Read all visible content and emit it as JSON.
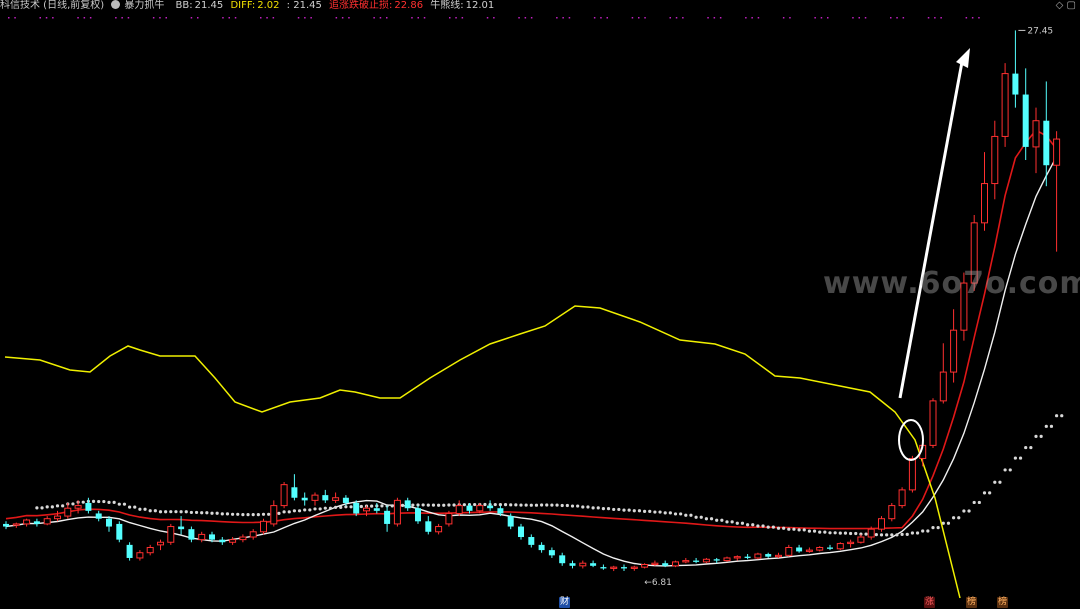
{
  "header": {
    "stock": "科信技术 (日线,前复权)",
    "indicator": "暴力抓牛",
    "bb_label": "BB:",
    "bb_value": "21.45",
    "diff_label": "DIFF:",
    "diff_value": "2.02",
    "sep_value": ": 21.45",
    "stop_label": "追涨跌破止损:",
    "stop_value": "22.86",
    "bull_label": "牛熊线:",
    "bull_value": "12.01"
  },
  "labels": {
    "high": "27.45",
    "low": "6.81"
  },
  "badges": {
    "finance": "财",
    "zhang": "涨",
    "bang1": "榜",
    "bang2": "榜"
  },
  "watermark": "www.6o7o.com",
  "colors": {
    "bg": "#000000",
    "up": "#ff3030",
    "down": "#54ffff",
    "yellow_line": "#f0f000",
    "red_line": "#e01818",
    "white_line": "#f0f0f0",
    "dots": "#d8d8d8",
    "bb": "#d0d0d0",
    "diff": "#f0e000",
    "stop": "#ff3030"
  },
  "chart_data": {
    "type": "candlestick",
    "ylim": [
      6,
      28
    ],
    "high_value": 27.45,
    "low_value": 6.81,
    "candles": [
      [
        8.6,
        8.7,
        8.4,
        8.5
      ],
      [
        8.55,
        8.65,
        8.45,
        8.6
      ],
      [
        8.6,
        8.8,
        8.5,
        8.75
      ],
      [
        8.7,
        8.8,
        8.5,
        8.6
      ],
      [
        8.6,
        8.9,
        8.55,
        8.8
      ],
      [
        8.8,
        9.1,
        8.7,
        8.9
      ],
      [
        8.9,
        9.4,
        8.8,
        9.2
      ],
      [
        9.2,
        9.5,
        9.0,
        9.3
      ],
      [
        9.4,
        9.6,
        9.0,
        9.1
      ],
      [
        9.0,
        9.1,
        8.7,
        8.8
      ],
      [
        8.8,
        8.9,
        8.3,
        8.5
      ],
      [
        8.6,
        8.7,
        7.9,
        8.0
      ],
      [
        7.8,
        7.9,
        7.2,
        7.3
      ],
      [
        7.3,
        7.6,
        7.2,
        7.5
      ],
      [
        7.5,
        7.8,
        7.4,
        7.7
      ],
      [
        7.8,
        8.0,
        7.6,
        7.9
      ],
      [
        7.9,
        8.6,
        7.8,
        8.5
      ],
      [
        8.5,
        8.9,
        8.2,
        8.4
      ],
      [
        8.4,
        8.5,
        7.9,
        8.0
      ],
      [
        8.0,
        8.3,
        7.9,
        8.2
      ],
      [
        8.2,
        8.3,
        7.9,
        8.0
      ],
      [
        8.0,
        8.1,
        7.8,
        7.9
      ],
      [
        7.9,
        8.1,
        7.8,
        8.0
      ],
      [
        8.0,
        8.2,
        7.9,
        8.1
      ],
      [
        8.1,
        8.4,
        8.0,
        8.3
      ],
      [
        8.3,
        8.8,
        8.2,
        8.7
      ],
      [
        8.6,
        9.5,
        8.5,
        9.3
      ],
      [
        9.3,
        10.2,
        9.2,
        10.1
      ],
      [
        10.0,
        10.5,
        9.5,
        9.6
      ],
      [
        9.6,
        9.8,
        9.3,
        9.5
      ],
      [
        9.5,
        9.8,
        9.3,
        9.7
      ],
      [
        9.7,
        9.9,
        9.4,
        9.5
      ],
      [
        9.5,
        9.8,
        9.4,
        9.6
      ],
      [
        9.6,
        9.7,
        9.3,
        9.4
      ],
      [
        9.4,
        9.5,
        8.9,
        9.0
      ],
      [
        9.1,
        9.3,
        8.9,
        9.2
      ],
      [
        9.2,
        9.4,
        9.0,
        9.1
      ],
      [
        9.1,
        9.3,
        8.3,
        8.6
      ],
      [
        8.6,
        9.6,
        8.5,
        9.5
      ],
      [
        9.5,
        9.6,
        9.1,
        9.2
      ],
      [
        9.2,
        9.3,
        8.6,
        8.7
      ],
      [
        8.7,
        8.9,
        8.2,
        8.3
      ],
      [
        8.3,
        8.6,
        8.2,
        8.5
      ],
      [
        8.6,
        9.1,
        8.5,
        9.0
      ],
      [
        9.0,
        9.5,
        8.9,
        9.3
      ],
      [
        9.3,
        9.4,
        9.0,
        9.1
      ],
      [
        9.1,
        9.4,
        9.0,
        9.3
      ],
      [
        9.3,
        9.5,
        9.1,
        9.2
      ],
      [
        9.2,
        9.3,
        8.9,
        9.0
      ],
      [
        8.9,
        9.0,
        8.4,
        8.5
      ],
      [
        8.5,
        8.6,
        8.0,
        8.1
      ],
      [
        8.1,
        8.2,
        7.7,
        7.8
      ],
      [
        7.8,
        7.9,
        7.5,
        7.6
      ],
      [
        7.6,
        7.7,
        7.3,
        7.4
      ],
      [
        7.4,
        7.5,
        7.0,
        7.1
      ],
      [
        7.1,
        7.2,
        6.9,
        7.0
      ],
      [
        7.0,
        7.2,
        6.9,
        7.1
      ],
      [
        7.1,
        7.2,
        6.95,
        7.0
      ],
      [
        6.95,
        7.05,
        6.85,
        6.9
      ],
      [
        6.9,
        7.0,
        6.8,
        6.95
      ],
      [
        6.95,
        7.05,
        6.8,
        6.9
      ],
      [
        6.9,
        7.0,
        6.81,
        6.95
      ],
      [
        6.95,
        7.1,
        6.9,
        7.05
      ],
      [
        7.05,
        7.2,
        7.0,
        7.1
      ],
      [
        7.1,
        7.2,
        6.95,
        7.0
      ],
      [
        7.0,
        7.2,
        6.95,
        7.15
      ],
      [
        7.15,
        7.3,
        7.1,
        7.2
      ],
      [
        7.2,
        7.3,
        7.1,
        7.15
      ],
      [
        7.15,
        7.3,
        7.1,
        7.25
      ],
      [
        7.25,
        7.3,
        7.1,
        7.2
      ],
      [
        7.2,
        7.35,
        7.15,
        7.3
      ],
      [
        7.3,
        7.4,
        7.2,
        7.35
      ],
      [
        7.35,
        7.45,
        7.25,
        7.3
      ],
      [
        7.3,
        7.5,
        7.25,
        7.45
      ],
      [
        7.45,
        7.5,
        7.3,
        7.35
      ],
      [
        7.35,
        7.5,
        7.3,
        7.4
      ],
      [
        7.4,
        7.8,
        7.35,
        7.7
      ],
      [
        7.7,
        7.8,
        7.5,
        7.55
      ],
      [
        7.55,
        7.7,
        7.5,
        7.6
      ],
      [
        7.6,
        7.75,
        7.55,
        7.7
      ],
      [
        7.7,
        7.8,
        7.6,
        7.65
      ],
      [
        7.65,
        7.9,
        7.6,
        7.85
      ],
      [
        7.85,
        8.0,
        7.7,
        7.9
      ],
      [
        7.9,
        8.2,
        7.85,
        8.1
      ],
      [
        8.1,
        8.5,
        8.0,
        8.4
      ],
      [
        8.4,
        8.9,
        8.3,
        8.8
      ],
      [
        8.8,
        9.4,
        8.7,
        9.3
      ],
      [
        9.3,
        10.0,
        9.2,
        9.9
      ],
      [
        9.9,
        11.2,
        9.8,
        11.1
      ],
      [
        11.1,
        12.0,
        10.8,
        11.6
      ],
      [
        11.6,
        13.4,
        11.5,
        13.3
      ],
      [
        13.3,
        15.5,
        13.2,
        14.4
      ],
      [
        14.4,
        16.8,
        14.0,
        16.0
      ],
      [
        16.0,
        18.2,
        15.6,
        17.8
      ],
      [
        17.8,
        20.4,
        17.5,
        20.1
      ],
      [
        20.1,
        22.8,
        19.8,
        21.6
      ],
      [
        21.6,
        24.0,
        21.0,
        23.4
      ],
      [
        23.4,
        26.2,
        23.0,
        25.8
      ],
      [
        25.8,
        27.45,
        24.5,
        25.0
      ],
      [
        25.0,
        26.0,
        22.5,
        23.0
      ],
      [
        23.0,
        24.5,
        22.0,
        24.0
      ],
      [
        24.0,
        25.5,
        21.5,
        22.3
      ],
      [
        22.3,
        23.6,
        19.0,
        23.3
      ]
    ]
  }
}
